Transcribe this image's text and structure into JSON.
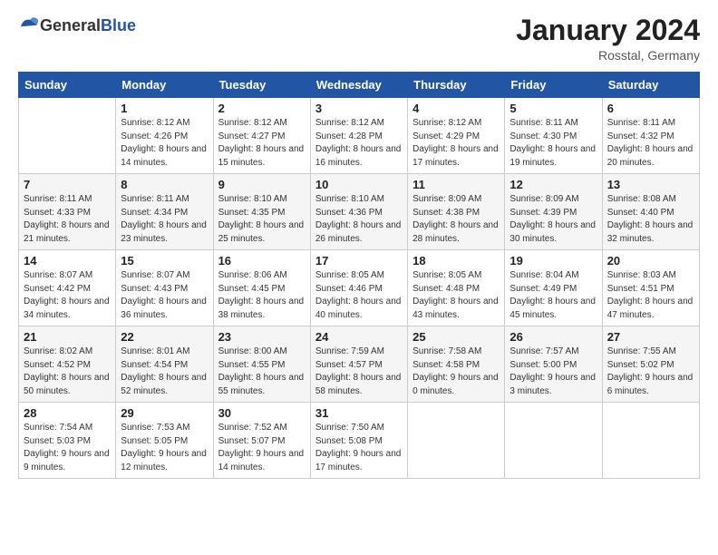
{
  "logo": {
    "general": "General",
    "blue": "Blue"
  },
  "header": {
    "month_title": "January 2024",
    "location": "Rosstal, Germany"
  },
  "days_of_week": [
    "Sunday",
    "Monday",
    "Tuesday",
    "Wednesday",
    "Thursday",
    "Friday",
    "Saturday"
  ],
  "weeks": [
    [
      {
        "day": "",
        "sunrise": "",
        "sunset": "",
        "daylight": ""
      },
      {
        "day": "1",
        "sunrise": "Sunrise: 8:12 AM",
        "sunset": "Sunset: 4:26 PM",
        "daylight": "Daylight: 8 hours and 14 minutes."
      },
      {
        "day": "2",
        "sunrise": "Sunrise: 8:12 AM",
        "sunset": "Sunset: 4:27 PM",
        "daylight": "Daylight: 8 hours and 15 minutes."
      },
      {
        "day": "3",
        "sunrise": "Sunrise: 8:12 AM",
        "sunset": "Sunset: 4:28 PM",
        "daylight": "Daylight: 8 hours and 16 minutes."
      },
      {
        "day": "4",
        "sunrise": "Sunrise: 8:12 AM",
        "sunset": "Sunset: 4:29 PM",
        "daylight": "Daylight: 8 hours and 17 minutes."
      },
      {
        "day": "5",
        "sunrise": "Sunrise: 8:11 AM",
        "sunset": "Sunset: 4:30 PM",
        "daylight": "Daylight: 8 hours and 19 minutes."
      },
      {
        "day": "6",
        "sunrise": "Sunrise: 8:11 AM",
        "sunset": "Sunset: 4:32 PM",
        "daylight": "Daylight: 8 hours and 20 minutes."
      }
    ],
    [
      {
        "day": "7",
        "sunrise": "Sunrise: 8:11 AM",
        "sunset": "Sunset: 4:33 PM",
        "daylight": "Daylight: 8 hours and 21 minutes."
      },
      {
        "day": "8",
        "sunrise": "Sunrise: 8:11 AM",
        "sunset": "Sunset: 4:34 PM",
        "daylight": "Daylight: 8 hours and 23 minutes."
      },
      {
        "day": "9",
        "sunrise": "Sunrise: 8:10 AM",
        "sunset": "Sunset: 4:35 PM",
        "daylight": "Daylight: 8 hours and 25 minutes."
      },
      {
        "day": "10",
        "sunrise": "Sunrise: 8:10 AM",
        "sunset": "Sunset: 4:36 PM",
        "daylight": "Daylight: 8 hours and 26 minutes."
      },
      {
        "day": "11",
        "sunrise": "Sunrise: 8:09 AM",
        "sunset": "Sunset: 4:38 PM",
        "daylight": "Daylight: 8 hours and 28 minutes."
      },
      {
        "day": "12",
        "sunrise": "Sunrise: 8:09 AM",
        "sunset": "Sunset: 4:39 PM",
        "daylight": "Daylight: 8 hours and 30 minutes."
      },
      {
        "day": "13",
        "sunrise": "Sunrise: 8:08 AM",
        "sunset": "Sunset: 4:40 PM",
        "daylight": "Daylight: 8 hours and 32 minutes."
      }
    ],
    [
      {
        "day": "14",
        "sunrise": "Sunrise: 8:07 AM",
        "sunset": "Sunset: 4:42 PM",
        "daylight": "Daylight: 8 hours and 34 minutes."
      },
      {
        "day": "15",
        "sunrise": "Sunrise: 8:07 AM",
        "sunset": "Sunset: 4:43 PM",
        "daylight": "Daylight: 8 hours and 36 minutes."
      },
      {
        "day": "16",
        "sunrise": "Sunrise: 8:06 AM",
        "sunset": "Sunset: 4:45 PM",
        "daylight": "Daylight: 8 hours and 38 minutes."
      },
      {
        "day": "17",
        "sunrise": "Sunrise: 8:05 AM",
        "sunset": "Sunset: 4:46 PM",
        "daylight": "Daylight: 8 hours and 40 minutes."
      },
      {
        "day": "18",
        "sunrise": "Sunrise: 8:05 AM",
        "sunset": "Sunset: 4:48 PM",
        "daylight": "Daylight: 8 hours and 43 minutes."
      },
      {
        "day": "19",
        "sunrise": "Sunrise: 8:04 AM",
        "sunset": "Sunset: 4:49 PM",
        "daylight": "Daylight: 8 hours and 45 minutes."
      },
      {
        "day": "20",
        "sunrise": "Sunrise: 8:03 AM",
        "sunset": "Sunset: 4:51 PM",
        "daylight": "Daylight: 8 hours and 47 minutes."
      }
    ],
    [
      {
        "day": "21",
        "sunrise": "Sunrise: 8:02 AM",
        "sunset": "Sunset: 4:52 PM",
        "daylight": "Daylight: 8 hours and 50 minutes."
      },
      {
        "day": "22",
        "sunrise": "Sunrise: 8:01 AM",
        "sunset": "Sunset: 4:54 PM",
        "daylight": "Daylight: 8 hours and 52 minutes."
      },
      {
        "day": "23",
        "sunrise": "Sunrise: 8:00 AM",
        "sunset": "Sunset: 4:55 PM",
        "daylight": "Daylight: 8 hours and 55 minutes."
      },
      {
        "day": "24",
        "sunrise": "Sunrise: 7:59 AM",
        "sunset": "Sunset: 4:57 PM",
        "daylight": "Daylight: 8 hours and 58 minutes."
      },
      {
        "day": "25",
        "sunrise": "Sunrise: 7:58 AM",
        "sunset": "Sunset: 4:58 PM",
        "daylight": "Daylight: 9 hours and 0 minutes."
      },
      {
        "day": "26",
        "sunrise": "Sunrise: 7:57 AM",
        "sunset": "Sunset: 5:00 PM",
        "daylight": "Daylight: 9 hours and 3 minutes."
      },
      {
        "day": "27",
        "sunrise": "Sunrise: 7:55 AM",
        "sunset": "Sunset: 5:02 PM",
        "daylight": "Daylight: 9 hours and 6 minutes."
      }
    ],
    [
      {
        "day": "28",
        "sunrise": "Sunrise: 7:54 AM",
        "sunset": "Sunset: 5:03 PM",
        "daylight": "Daylight: 9 hours and 9 minutes."
      },
      {
        "day": "29",
        "sunrise": "Sunrise: 7:53 AM",
        "sunset": "Sunset: 5:05 PM",
        "daylight": "Daylight: 9 hours and 12 minutes."
      },
      {
        "day": "30",
        "sunrise": "Sunrise: 7:52 AM",
        "sunset": "Sunset: 5:07 PM",
        "daylight": "Daylight: 9 hours and 14 minutes."
      },
      {
        "day": "31",
        "sunrise": "Sunrise: 7:50 AM",
        "sunset": "Sunset: 5:08 PM",
        "daylight": "Daylight: 9 hours and 17 minutes."
      },
      {
        "day": "",
        "sunrise": "",
        "sunset": "",
        "daylight": ""
      },
      {
        "day": "",
        "sunrise": "",
        "sunset": "",
        "daylight": ""
      },
      {
        "day": "",
        "sunrise": "",
        "sunset": "",
        "daylight": ""
      }
    ]
  ]
}
